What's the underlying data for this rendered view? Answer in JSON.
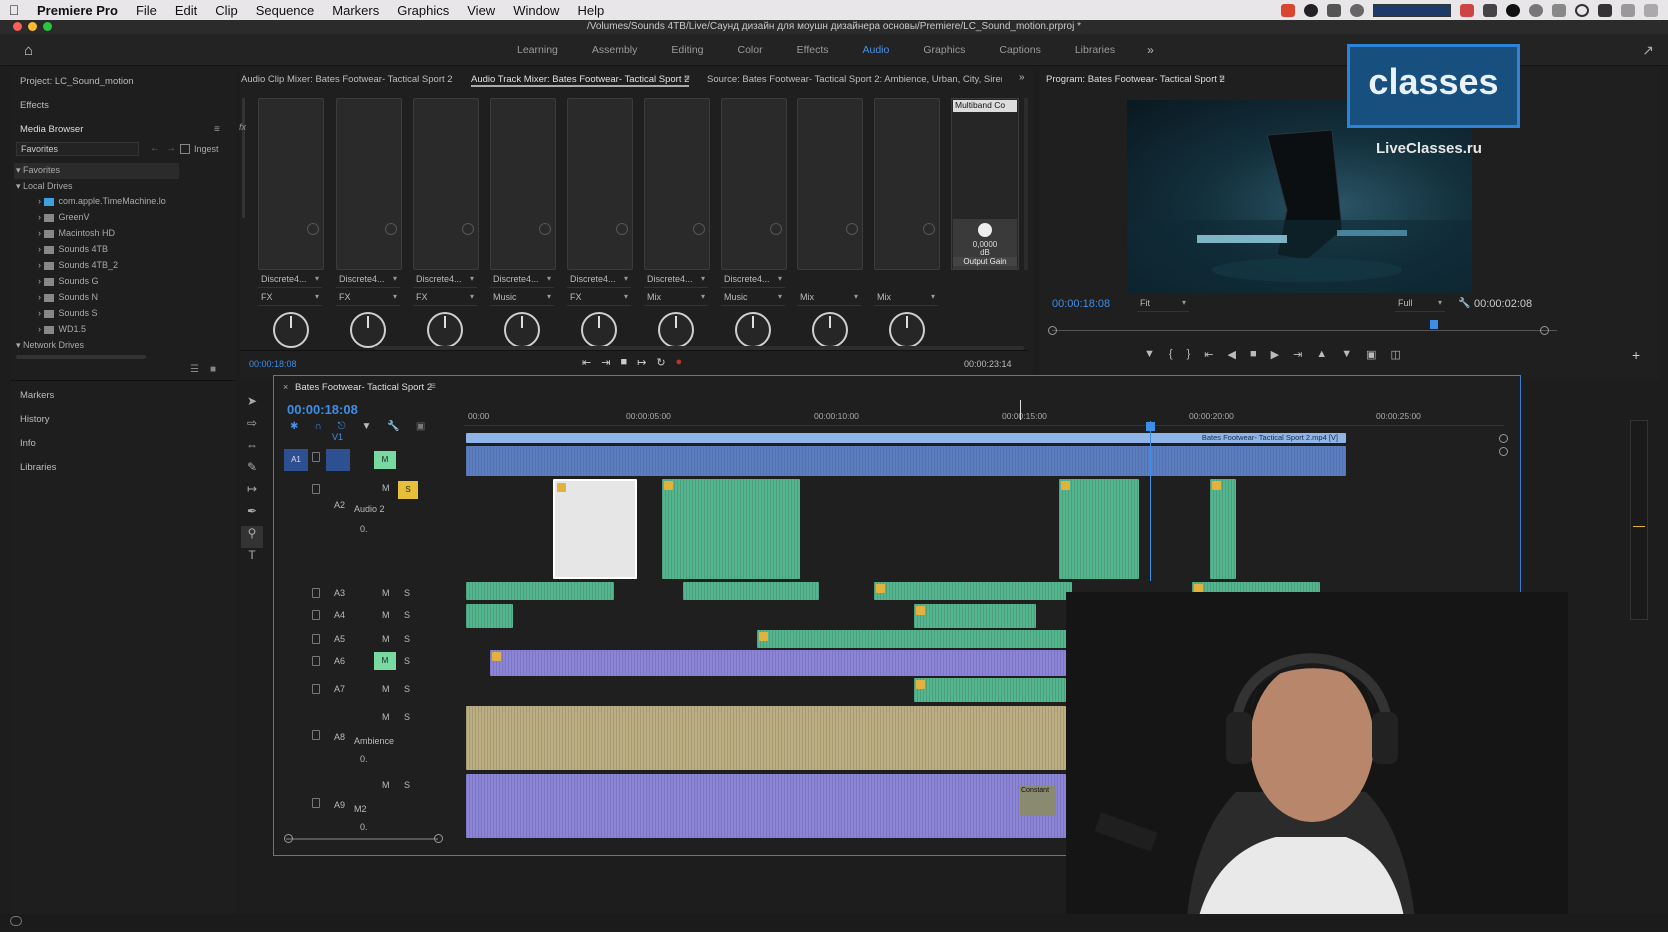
{
  "menubar": {
    "app_name": "Premiere Pro",
    "items": [
      "File",
      "Edit",
      "Clip",
      "Sequence",
      "Markers",
      "Graphics",
      "View",
      "Window",
      "Help"
    ]
  },
  "window": {
    "title": "/Volumes/Sounds 4TB/Live/Саунд дизайн для моушн дизайнера основы/Premiere/LC_Sound_motion.prproj *"
  },
  "workspaces": {
    "tabs": [
      "Learning",
      "Assembly",
      "Editing",
      "Color",
      "Effects",
      "Audio",
      "Graphics",
      "Captions",
      "Libraries"
    ],
    "active": "Audio",
    "more": "»"
  },
  "left": {
    "project_label": "Project: LC_Sound_motion",
    "effects_label": "Effects",
    "media_browser_label": "Media Browser",
    "favorites_select": "Favorites",
    "ingest_label": "Ingest",
    "favorites_node": "Favorites",
    "local_drives_node": "Local Drives",
    "drives": [
      "com.apple.TimeMachine.lo",
      "GreenV",
      "Macintosh HD",
      "Sounds 4TB",
      "Sounds 4TB_2",
      "Sounds G",
      "Sounds N",
      "Sounds S",
      "WD1.5"
    ],
    "network_drives_node": "Network Drives",
    "lower_panels": [
      "Markers",
      "History",
      "Info",
      "Libraries"
    ]
  },
  "mixer": {
    "tabs": [
      "Audio Clip Mixer: Bates Footwear- Tactical Sport 2",
      "Audio Track Mixer: Bates Footwear- Tactical Sport 2",
      "Source: Bates Footwear- Tactical Sport 2: Ambience, Urban, City, Siren, Tra"
    ],
    "fx_label": "fx",
    "channels": [
      {
        "preset": "Discrete4...",
        "type": "FX"
      },
      {
        "preset": "Discrete4...",
        "type": "FX"
      },
      {
        "preset": "Discrete4...",
        "type": "FX"
      },
      {
        "preset": "Discrete4...",
        "type": "Music"
      },
      {
        "preset": "Discrete4...",
        "type": "FX"
      },
      {
        "preset": "Discrete4...",
        "type": "Mix"
      },
      {
        "preset": "Discrete4...",
        "type": "Music"
      },
      {
        "preset": "",
        "type": "Mix"
      },
      {
        "preset": "",
        "type": "Mix"
      }
    ],
    "multiband_label": "Multiband Co",
    "gain_value": "0,0000",
    "gain_unit": "dB",
    "output_gain_label": "Output Gain",
    "timecode_in": "00:00:18:08",
    "timecode_out": "00:00:23:14"
  },
  "program": {
    "title": "Program: Bates Footwear- Tactical Sport 2",
    "timecode": "00:00:18:08",
    "fit_label": "Fit",
    "full_label": "Full",
    "duration": "00:00:02:08"
  },
  "overlay": {
    "logo_text": "classes",
    "site_text": "LiveClasses.ru"
  },
  "timeline": {
    "sequence_name": "Bates Footwear- Tactical Sport 2",
    "timecode": "00:00:18:08",
    "ruler": [
      "00:00",
      "00:00:05:00",
      "00:00:10:00",
      "00:00:15:00",
      "00:00:20:00",
      "00:00:25:00"
    ],
    "video_clip_label": "Bates Footwear- Tactical Sport 2.mp4 [V]",
    "tracks": [
      {
        "id": "V1",
        "name": ""
      },
      {
        "id": "A1",
        "name": ""
      },
      {
        "id": "A2",
        "name": "Audio 2"
      },
      {
        "id": "A3",
        "name": ""
      },
      {
        "id": "A4",
        "name": ""
      },
      {
        "id": "A5",
        "name": ""
      },
      {
        "id": "A6",
        "name": ""
      },
      {
        "id": "A7",
        "name": ""
      },
      {
        "id": "A8",
        "name": "Ambience"
      },
      {
        "id": "A9",
        "name": "M2"
      }
    ],
    "track_buttons": {
      "mute": "M",
      "solo": "S",
      "volume": "0."
    },
    "constant_label": "Constant"
  },
  "colors": {
    "accent": "#3d8ee6",
    "green_wave": "#5fc49a",
    "purple_wave": "#9b92e0",
    "tan_wave": "#c6b98d",
    "blue_wave": "#6d8fcf",
    "logo": "#2c84d8"
  }
}
